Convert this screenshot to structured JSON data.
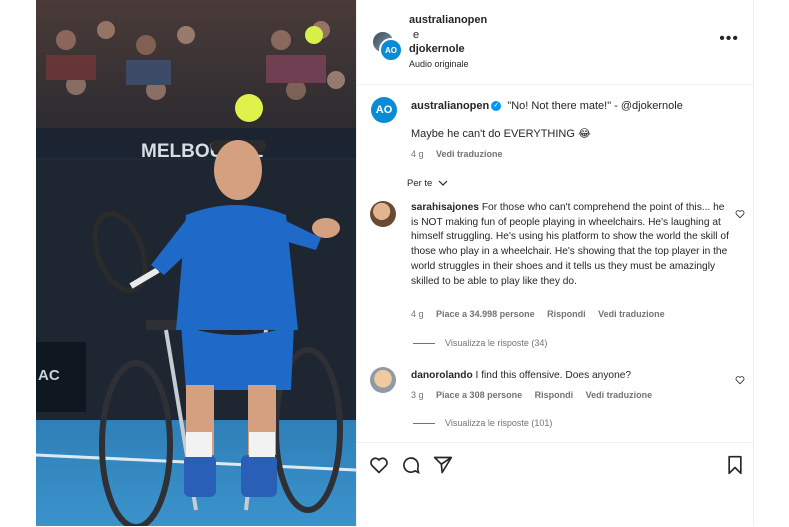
{
  "header": {
    "user1": "australianopen",
    "and": "e",
    "user2": "djokernole",
    "audio": "Audio originale",
    "more": "•••"
  },
  "post": {
    "author": "australianopen",
    "quote": "\"No! Not there mate!\" - @djokernole",
    "text": "Maybe he can't do EVERYTHING 😂",
    "time": "4 g",
    "translate": "Vedi traduzione",
    "avatar_label": "AO"
  },
  "filter": {
    "label": "Per te"
  },
  "media": {
    "banner": "MELBOURNE",
    "side_text": "AC"
  },
  "comments": [
    {
      "user": "sarahisajones",
      "text": "For those who can't comprehend the point of this... he is NOT making fun of people playing in wheelchairs. He's laughing at himself struggling. He's using his platform to show the world the skill of those who play in a wheelchair. He's showing that the top player in the world struggles in their shoes and it tells us they must be amazingly skilled to be able to play like they do.",
      "time": "4 g",
      "likes": "Piace a 34.998 persone",
      "reply": "Rispondi",
      "translate": "Vedi traduzione",
      "replies": "Visualizza le risposte (34)"
    },
    {
      "user": "danorolando",
      "text": "I find this offensive. Does anyone?",
      "time": "3 g",
      "likes": "Piace a 308 persone",
      "reply": "Rispondi",
      "translate": "Vedi traduzione",
      "replies": "Visualizza le risposte (101)"
    }
  ],
  "colors": {
    "accent": "#0095f6",
    "ao_blue": "#0a8bd6",
    "text": "#262626",
    "muted": "#737373"
  },
  "icons": [
    "heart-icon",
    "comment-icon",
    "share-icon",
    "bookmark-icon",
    "chevron-down-icon",
    "more-icon"
  ]
}
